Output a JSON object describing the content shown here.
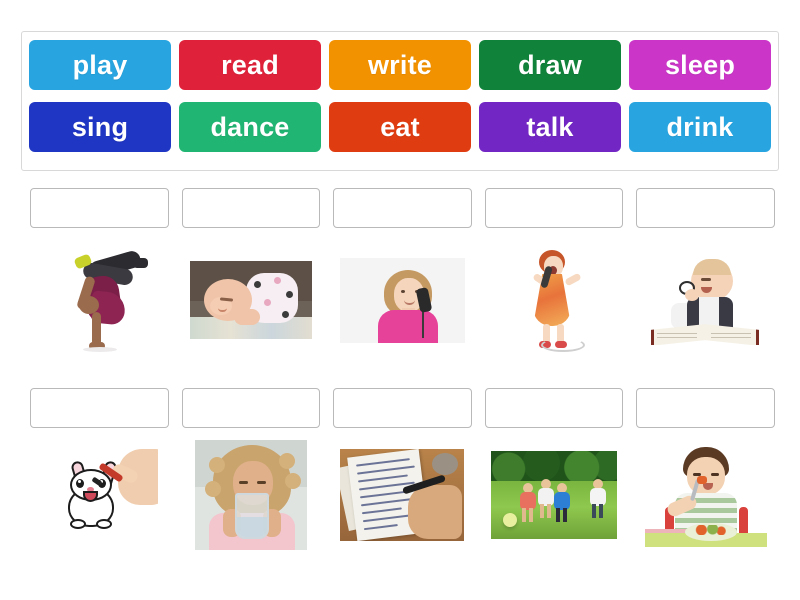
{
  "activity": {
    "type": "match-up-drag-drop",
    "word_bank": {
      "rows": [
        [
          {
            "label": "play",
            "color": "#28a5e0"
          },
          {
            "label": "read",
            "color": "#e0213a"
          },
          {
            "label": "write",
            "color": "#f39200"
          },
          {
            "label": "draw",
            "color": "#10823a"
          },
          {
            "label": "sleep",
            "color": "#cb36c8"
          }
        ],
        [
          {
            "label": "sing",
            "color": "#1f35c4"
          },
          {
            "label": "dance",
            "color": "#21b573"
          },
          {
            "label": "eat",
            "color": "#e03c11"
          },
          {
            "label": "talk",
            "color": "#7226c4"
          },
          {
            "label": "drink",
            "color": "#28a5e0"
          }
        ]
      ]
    },
    "rows": [
      {
        "dropzones": [
          {
            "value": "",
            "placeholder": ""
          },
          {
            "value": "",
            "placeholder": ""
          },
          {
            "value": "",
            "placeholder": ""
          },
          {
            "value": "",
            "placeholder": ""
          },
          {
            "value": "",
            "placeholder": ""
          }
        ],
        "images": [
          {
            "name": "breakdancer-handstand-image",
            "alt": "Breakdancer doing a one-handed handstand"
          },
          {
            "name": "sleeping-baby-image",
            "alt": "Newborn baby sleeping in a polka-dot hat"
          },
          {
            "name": "girl-on-telephone-image",
            "alt": "Girl in pink talking on a telephone"
          },
          {
            "name": "girl-singing-microphone-image",
            "alt": "Girl in orange dress singing into a microphone"
          },
          {
            "name": "baby-reading-book-image",
            "alt": "Baby with glasses reading an open book"
          }
        ]
      },
      {
        "dropzones": [
          {
            "value": "",
            "placeholder": ""
          },
          {
            "value": "",
            "placeholder": ""
          },
          {
            "value": "",
            "placeholder": ""
          },
          {
            "value": "",
            "placeholder": ""
          },
          {
            "value": "",
            "placeholder": ""
          }
        ],
        "images": [
          {
            "name": "hand-drawing-rabbit-image",
            "alt": "Hand drawing a cartoon rabbit with a pen"
          },
          {
            "name": "girl-drinking-water-image",
            "alt": "Curly-haired girl drinking a glass of water"
          },
          {
            "name": "hand-writing-letter-image",
            "alt": "Hand writing a handwritten letter on paper"
          },
          {
            "name": "children-playing-ball-image",
            "alt": "Four children playing with a ball on grass"
          },
          {
            "name": "boy-eating-vegetables-image",
            "alt": "Boy eating vegetables from a plate with a fork"
          }
        ]
      }
    ]
  },
  "theme": {
    "page_background": "#ffffff",
    "bank_border": "#d8d8d8",
    "dropzone_border": "#b9b9b9",
    "tile_text": "#ffffff"
  }
}
